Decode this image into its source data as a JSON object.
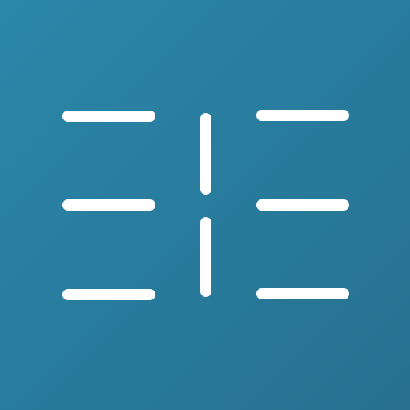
{
  "logo": {
    "name": "split-lines-logo",
    "background_start": "#2a87aa",
    "background_end": "#27708f",
    "bar_color": "#ffffff"
  }
}
